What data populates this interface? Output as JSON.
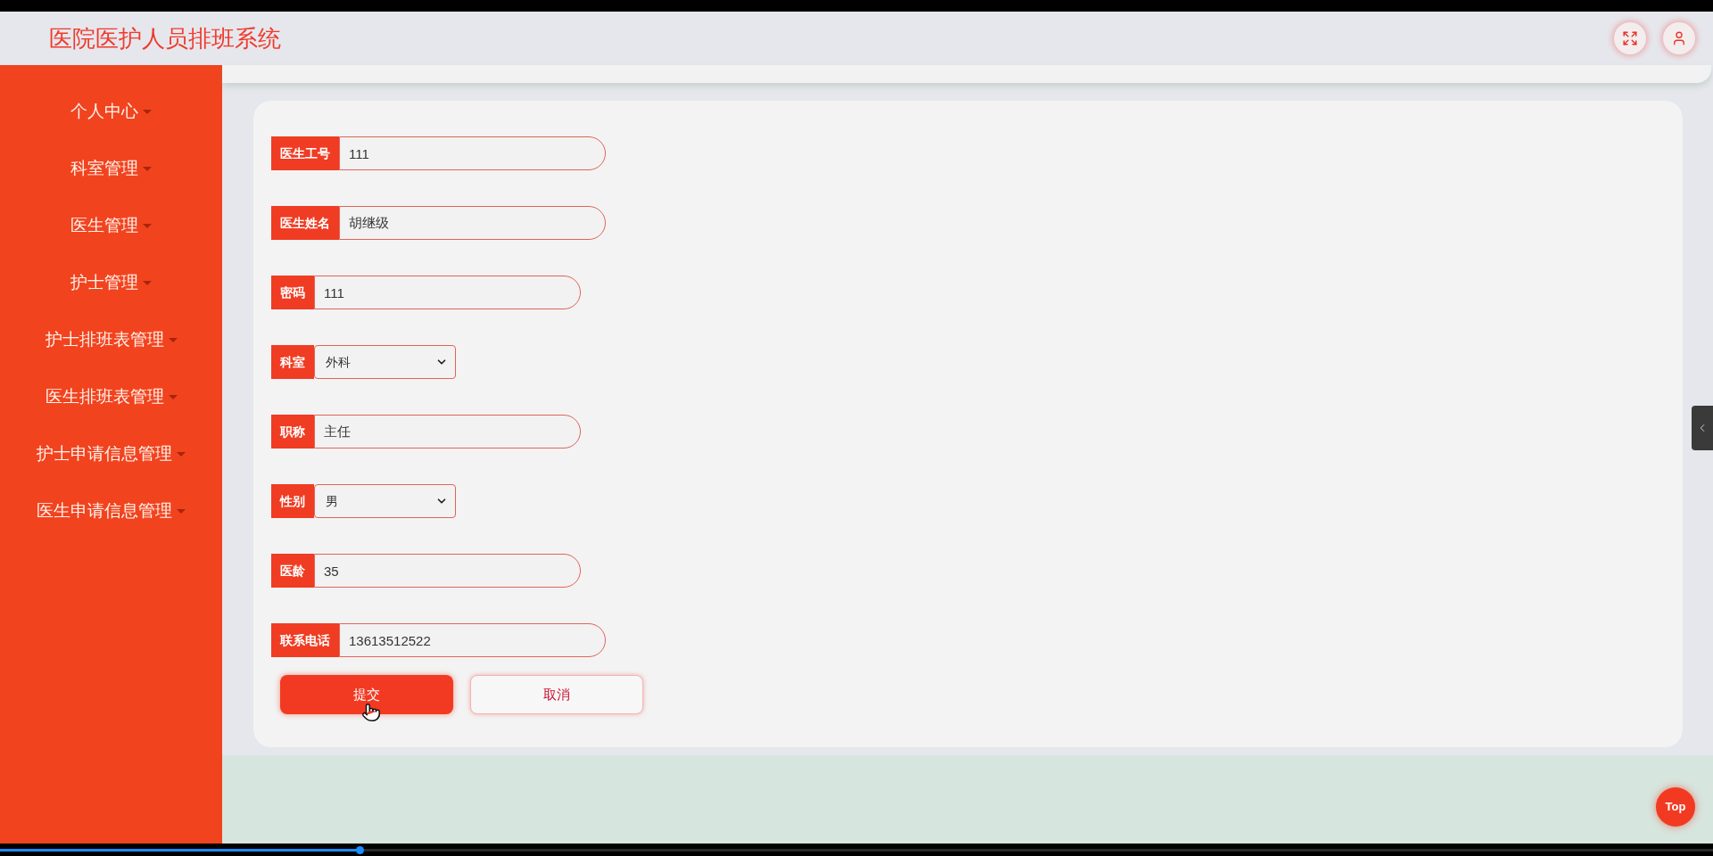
{
  "header": {
    "title": "医院医护人员排班系统"
  },
  "sidebar": {
    "items": [
      {
        "label": "个人中心"
      },
      {
        "label": "科室管理"
      },
      {
        "label": "医生管理"
      },
      {
        "label": "护士管理"
      },
      {
        "label": "护士排班表管理"
      },
      {
        "label": "医生排班表管理"
      },
      {
        "label": "护士申请信息管理"
      },
      {
        "label": "医生申请信息管理"
      }
    ]
  },
  "form": {
    "fields": [
      {
        "label": "医生工号",
        "kind": "text",
        "value": "111"
      },
      {
        "label": "医生姓名",
        "kind": "text",
        "value": "胡继级"
      },
      {
        "label": "密码",
        "kind": "text",
        "value": "111"
      },
      {
        "label": "科室",
        "kind": "select",
        "value": "外科"
      },
      {
        "label": "职称",
        "kind": "text",
        "value": "主任"
      },
      {
        "label": "性别",
        "kind": "select",
        "value": "男"
      },
      {
        "label": "医龄",
        "kind": "text",
        "value": "35"
      },
      {
        "label": "联系电话",
        "kind": "text",
        "value": "13613512522"
      }
    ],
    "buttons": [
      {
        "label": "提交",
        "kind": "primary"
      },
      {
        "label": "取消",
        "kind": "secondary"
      }
    ]
  },
  "back_to_top": {
    "label": "Top"
  },
  "video_player": {
    "progress": {
      "level": 0.21
    }
  }
}
